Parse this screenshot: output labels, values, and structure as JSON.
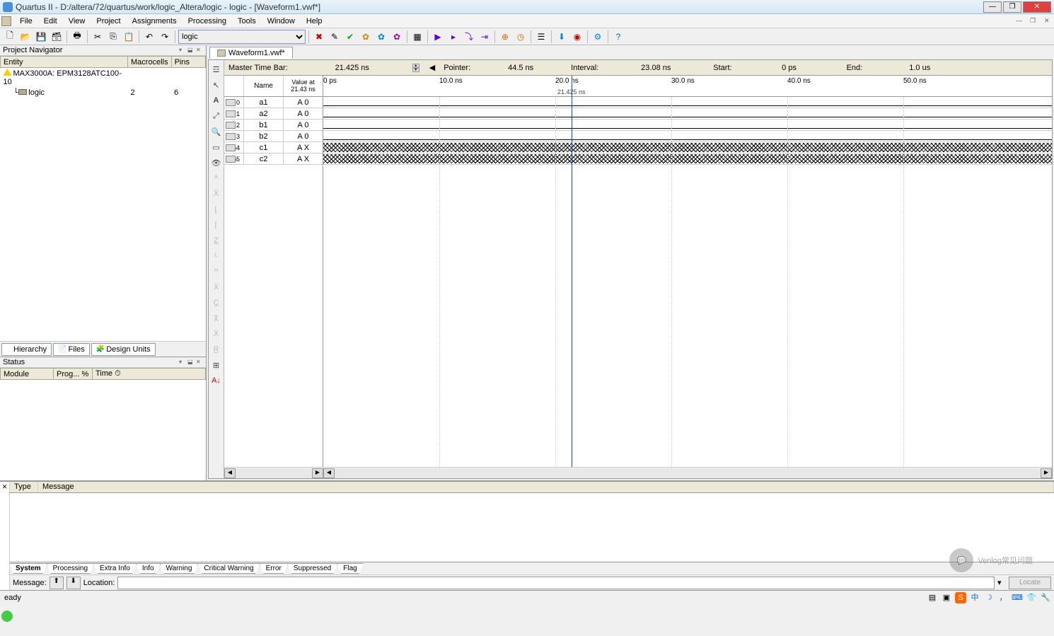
{
  "window": {
    "title": "Quartus II - D:/altera/72/quartus/work/logic_Altera/logic - logic - [Waveform1.vwf*]"
  },
  "menu": [
    "File",
    "Edit",
    "View",
    "Project",
    "Assignments",
    "Processing",
    "Tools",
    "Window",
    "Help"
  ],
  "toolbar": {
    "entity_select": "logic"
  },
  "panels": {
    "pnav_title": "Project Navigator",
    "pnav_cols": [
      "Entity",
      "Macrocells",
      "Pins"
    ],
    "device_row": "MAX3000A: EPM3128ATC100-10",
    "entity_row": {
      "name": "logic",
      "macrocells": "2",
      "pins": "6"
    },
    "pnav_tabs": [
      "Hierarchy",
      "Files",
      "Design Units"
    ],
    "status_title": "Status",
    "status_cols": [
      "Module",
      "Prog... %",
      "Time"
    ]
  },
  "editor_tab": "Waveform1.vwf*",
  "timebar": {
    "master_label": "Master Time Bar:",
    "master_val": "21.425 ns",
    "pointer_label": "Pointer:",
    "pointer_val": "44.5 ns",
    "interval_label": "Interval:",
    "interval_val": "23.08 ns",
    "start_label": "Start:",
    "start_val": "0 ps",
    "end_label": "End:",
    "end_val": "1.0 us"
  },
  "sig_head": {
    "name": "Name",
    "value": "Value at 21.43 ns"
  },
  "signals": [
    {
      "idx": "0",
      "name": "a1",
      "val": "A 0",
      "type": "in"
    },
    {
      "idx": "1",
      "name": "a2",
      "val": "A 0",
      "type": "in"
    },
    {
      "idx": "2",
      "name": "b1",
      "val": "A 0",
      "type": "in"
    },
    {
      "idx": "3",
      "name": "b2",
      "val": "A 0",
      "type": "in"
    },
    {
      "idx": "4",
      "name": "c1",
      "val": "A X",
      "type": "out"
    },
    {
      "idx": "5",
      "name": "c2",
      "val": "A X",
      "type": "out"
    }
  ],
  "ruler_ticks": [
    {
      "pos": 0,
      "label": "0 ps"
    },
    {
      "pos": 164,
      "label": "10.0 ns"
    },
    {
      "pos": 328,
      "label": "20.0 ns"
    },
    {
      "pos": 492,
      "label": "30.0 ns"
    },
    {
      "pos": 656,
      "label": "40.0 ns"
    },
    {
      "pos": 820,
      "label": "50.0 ns"
    }
  ],
  "cursor": {
    "pos": 351,
    "label": "21.425 ns"
  },
  "msg": {
    "cols": [
      "Type",
      "Message"
    ],
    "tabs": [
      "System",
      "Processing",
      "Extra Info",
      "Info",
      "Warning",
      "Critical Warning",
      "Error",
      "Suppressed",
      "Flag"
    ],
    "msg_label": "Message:",
    "loc_label": "Location:",
    "locate": "Locate"
  },
  "status_text": "eady",
  "watermark": "Verilog常见问题"
}
